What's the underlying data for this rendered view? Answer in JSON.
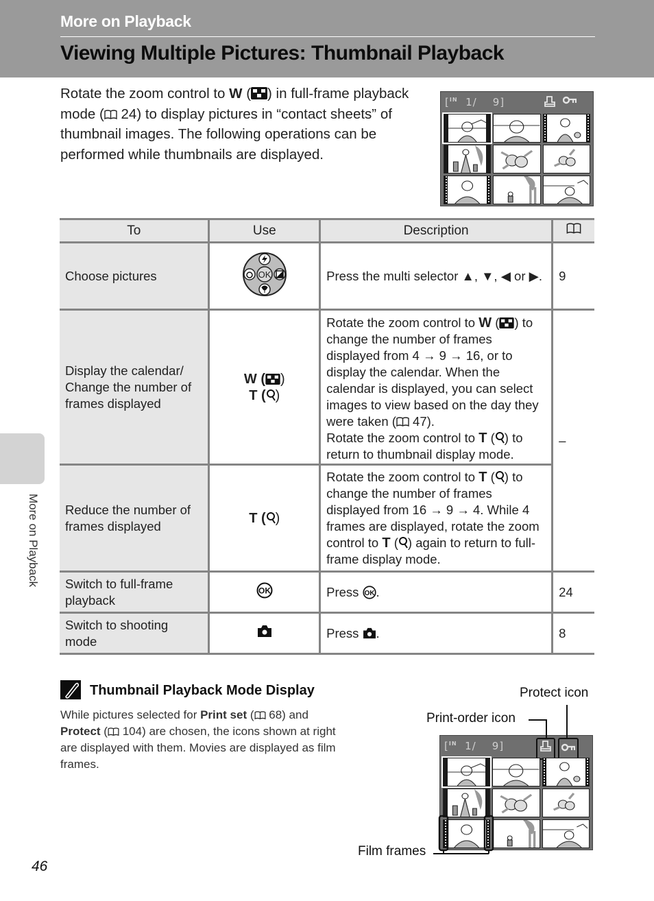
{
  "header": {
    "section": "More on Playback",
    "title": "Viewing Multiple Pictures: Thumbnail Playback",
    "band_color": "#9a9a9a"
  },
  "intro": {
    "part1": "Rotate the zoom control to ",
    "w_label": "W",
    "part2": ") in full-frame playback mode (",
    "ref": "24",
    "part3": ") to display pictures in “contact sheets” of thumbnail images. The following operations can be performed while thumbnails are displayed."
  },
  "lcd": {
    "memory_indicator": "IN",
    "counter": "1/",
    "total": "9]",
    "bracket": "[",
    "thumbnails": [
      {
        "subject": "woman-beach",
        "style": "bars",
        "selected": true
      },
      {
        "subject": "woman-closeup",
        "style": "plain",
        "selected": false
      },
      {
        "subject": "woman-child",
        "style": "film",
        "selected": false
      },
      {
        "subject": "family-tree",
        "style": "bars",
        "selected": false
      },
      {
        "subject": "flowers",
        "style": "plain",
        "selected": false
      },
      {
        "subject": "flowers-small",
        "style": "plain",
        "selected": false
      },
      {
        "subject": "woman-portrait",
        "style": "film",
        "selected": false
      },
      {
        "subject": "child-tree",
        "style": "plain",
        "selected": false
      },
      {
        "subject": "woman-beach-2",
        "style": "plain",
        "selected": false
      }
    ]
  },
  "table": {
    "headers": {
      "to": "To",
      "use": "Use",
      "description": "Description",
      "page_icon": "book-icon"
    },
    "rows": [
      {
        "to": "Choose pictures",
        "use_icon": "multi-selector-icon",
        "description": "Press the multi selector ▲, ▼, ◀ or ▶.",
        "page": "9"
      },
      {
        "to": "Display the calendar/ Change the number of frames displayed",
        "use_w": "W (",
        "use_t": "T (",
        "desc_a1": "Rotate the zoom control to ",
        "desc_a_w": "W",
        "desc_a2": ") to change the number of frames displayed from 4 → 9 → 16, or to display the calendar. When the calendar is displayed, you can select images to view based on the day they were taken (",
        "desc_a_ref": "47",
        "desc_a3": ").",
        "desc_b1": "Rotate the zoom control to ",
        "desc_b_t": "T",
        "desc_b2": ") to return to thumbnail display mode.",
        "page": "–"
      },
      {
        "to": "Reduce the number of frames displayed",
        "use_t": "T (",
        "desc1": "Rotate the zoom control to ",
        "desc_t": "T",
        "desc2": ") to change the number of frames displayed from 16 → 9 → 4. While 4 frames are displayed, rotate the zoom control to ",
        "desc_t2": "T",
        "desc3": ") again to return to full-frame display mode."
      },
      {
        "to": "Switch to full-frame playback",
        "use_icon": "ok-button-icon",
        "description_prefix": "Press ",
        "description_suffix": ".",
        "page": "24"
      },
      {
        "to": "Switch to shooting mode",
        "use_icon": "camera-icon",
        "description_prefix": "Press ",
        "description_suffix": ".",
        "page": "8"
      }
    ]
  },
  "side_tab": {
    "label": "More on Playback"
  },
  "note": {
    "title": "Thumbnail Playback Mode Display",
    "body1": "While pictures selected for ",
    "print_set": "Print set",
    "body2": " (",
    "ref1": "68",
    "body3": ") and ",
    "protect": "Protect",
    "body4": " (",
    "ref2": "104",
    "body5": ") are chosen, the icons shown at right are displayed with them. Movies are displayed as film frames."
  },
  "callouts": {
    "protect": "Protect icon",
    "print_order": "Print-order icon",
    "film": "Film frames"
  },
  "page_number": "46"
}
